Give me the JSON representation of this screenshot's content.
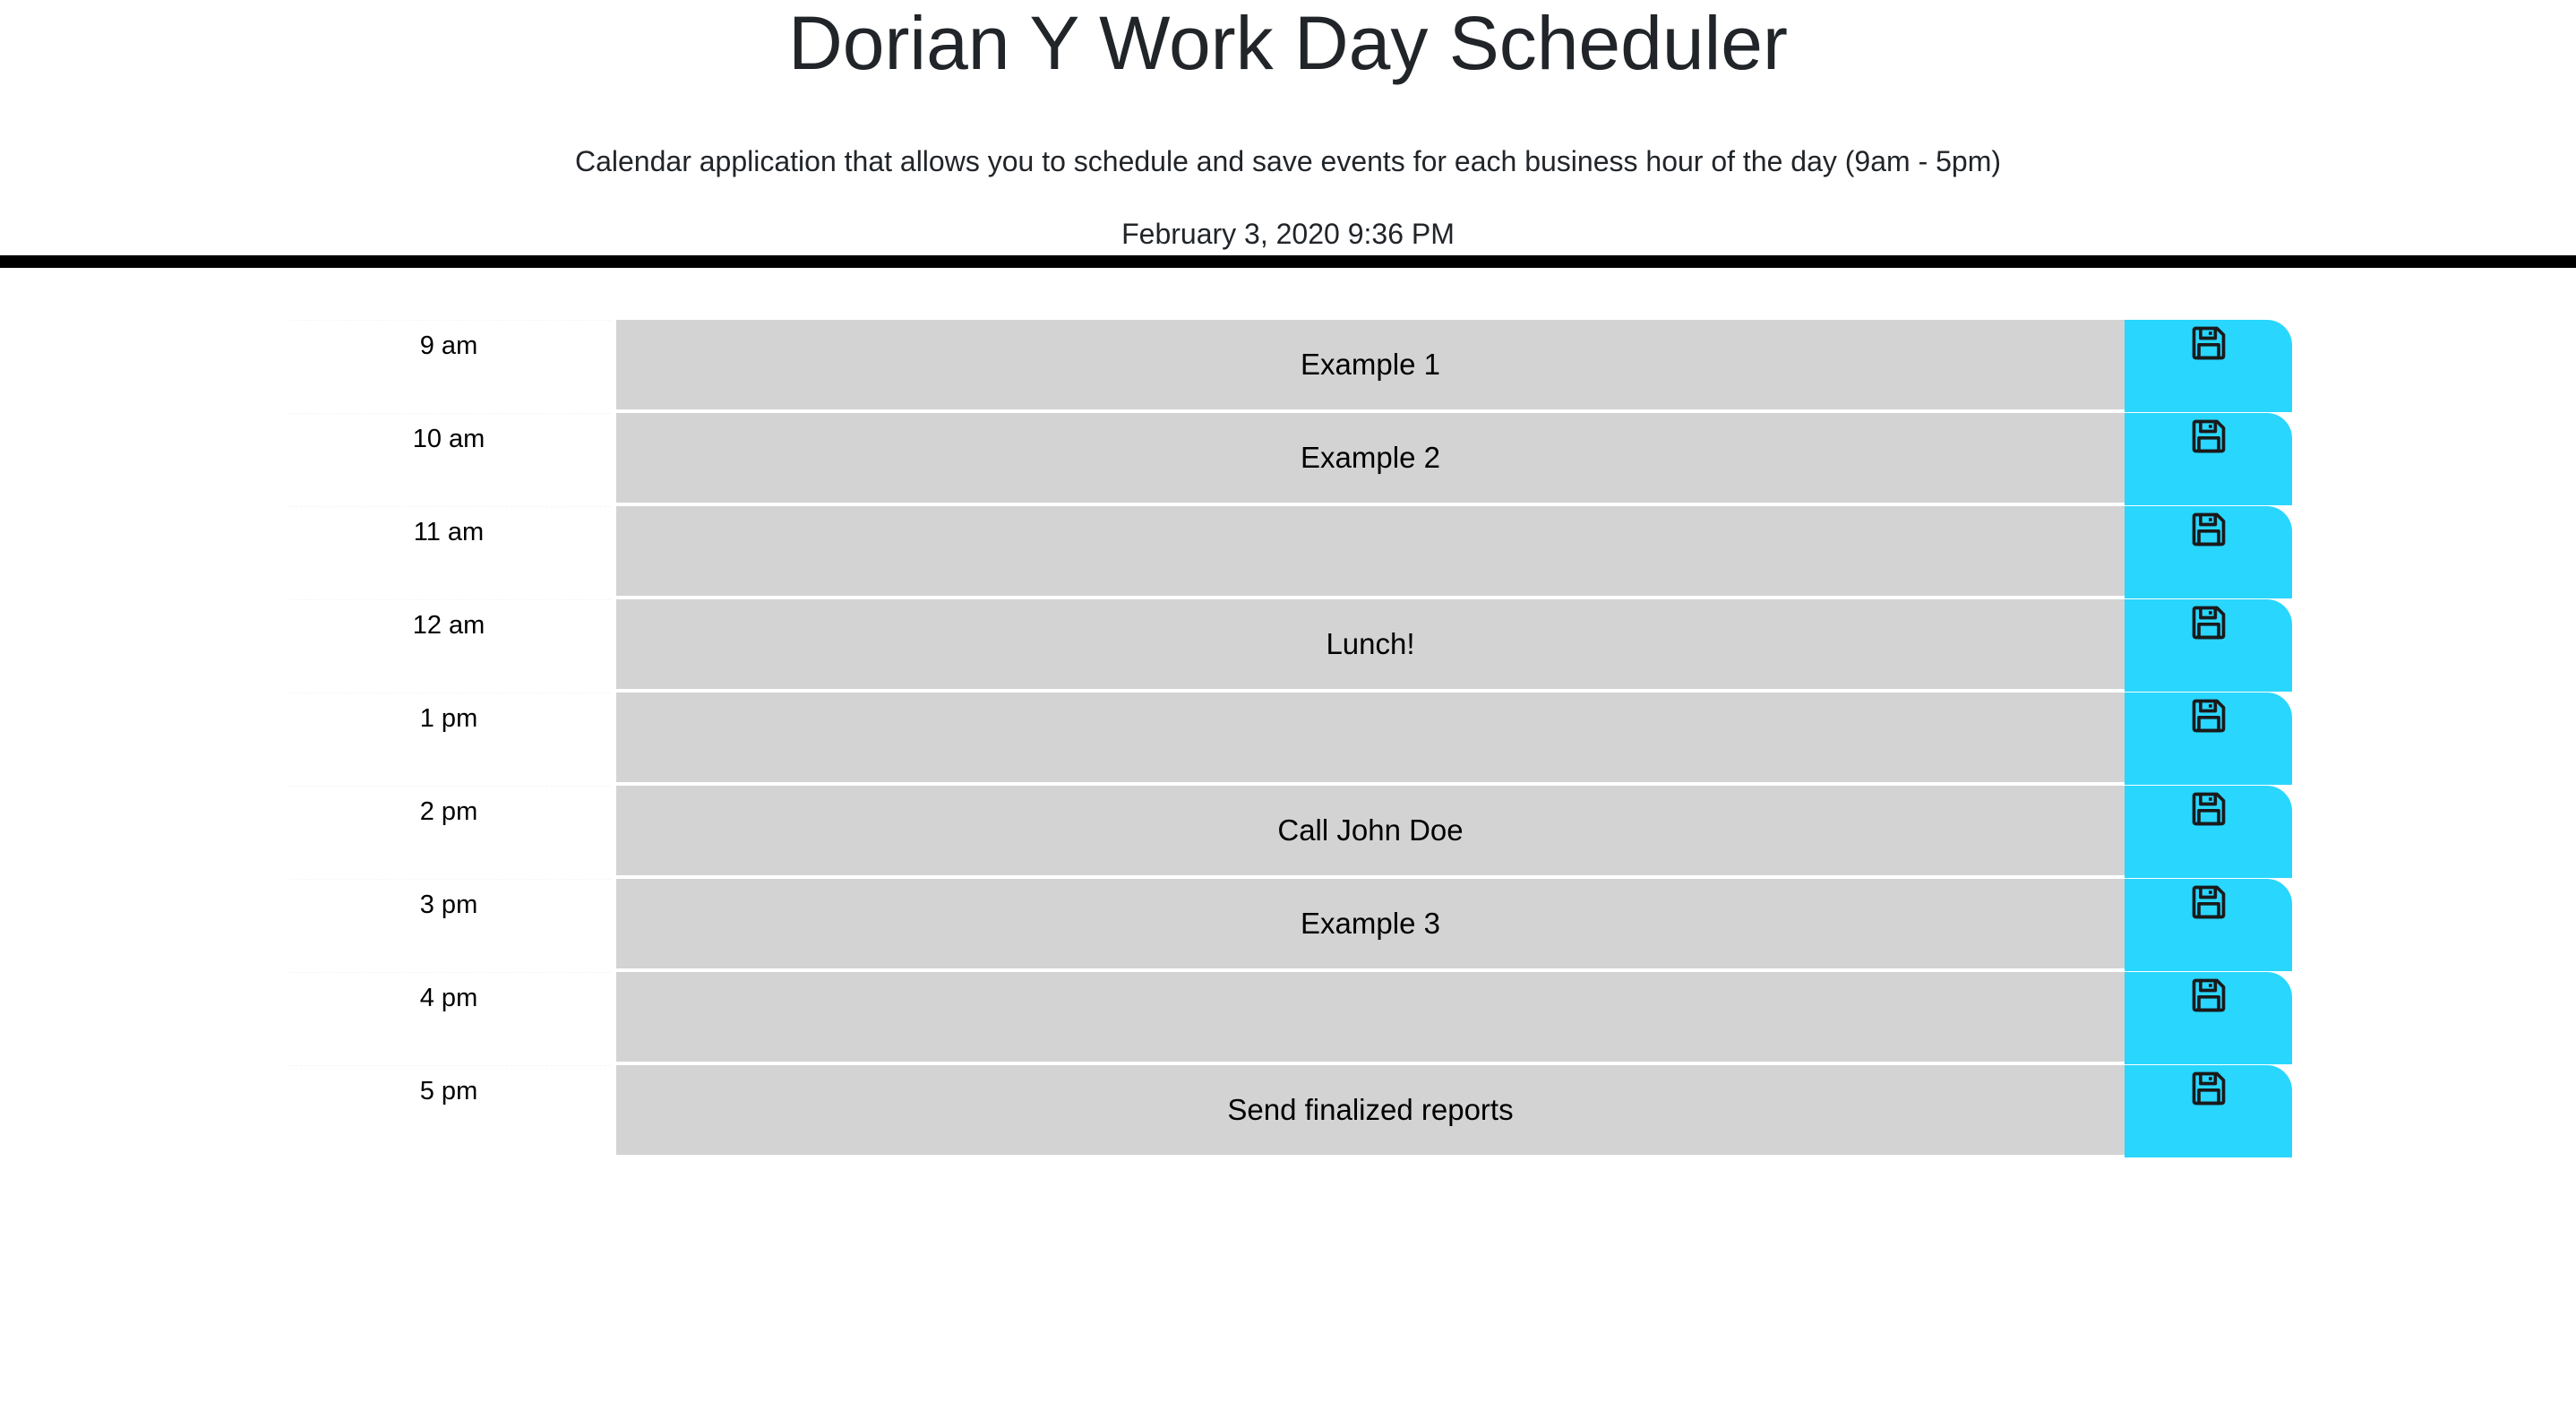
{
  "header": {
    "title": "Dorian Y Work Day Scheduler",
    "lead": "Calendar application that allows you to schedule and save events for each business hour of the day (9am - 5pm)",
    "current_day": "February 3, 2020 9:36 PM"
  },
  "colors": {
    "description_bg": "#d3d3d3",
    "save_button_bg": "#29d6fe",
    "divider": "#000000"
  },
  "time_blocks": [
    {
      "hour": "9 am",
      "text": "Example 1",
      "save_icon": "floppy-disk-icon"
    },
    {
      "hour": "10 am",
      "text": "Example 2",
      "save_icon": "floppy-disk-icon"
    },
    {
      "hour": "11 am",
      "text": "",
      "save_icon": "floppy-disk-icon"
    },
    {
      "hour": "12 am",
      "text": "Lunch!",
      "save_icon": "floppy-disk-icon"
    },
    {
      "hour": "1 pm",
      "text": "",
      "save_icon": "floppy-disk-icon"
    },
    {
      "hour": "2 pm",
      "text": "Call John Doe",
      "save_icon": "floppy-disk-icon"
    },
    {
      "hour": "3 pm",
      "text": "Example 3",
      "save_icon": "floppy-disk-icon"
    },
    {
      "hour": "4 pm",
      "text": "",
      "save_icon": "floppy-disk-icon"
    },
    {
      "hour": "5 pm",
      "text": "Send finalized reports",
      "save_icon": "floppy-disk-icon"
    }
  ]
}
